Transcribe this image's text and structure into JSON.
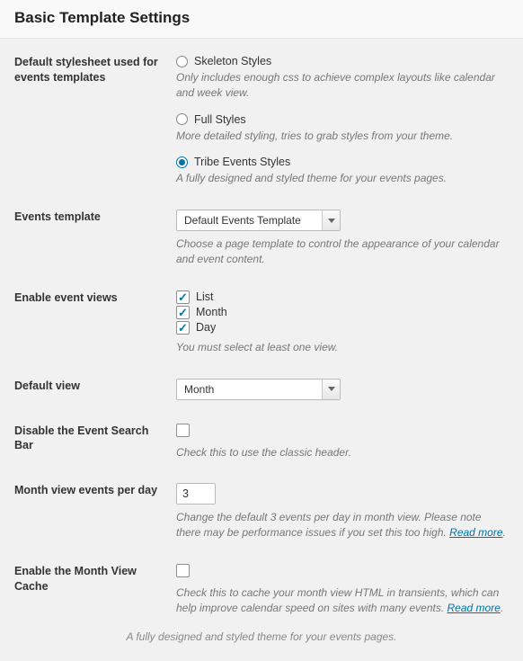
{
  "header": {
    "title": "Basic Template Settings"
  },
  "stylesheet": {
    "label": "Default stylesheet used for events templates",
    "options": [
      {
        "label": "Skeleton Styles",
        "desc": "Only includes enough css to achieve complex layouts like calendar and week view.",
        "checked": false
      },
      {
        "label": "Full Styles",
        "desc": "More detailed styling, tries to grab styles from your theme.",
        "checked": false
      },
      {
        "label": "Tribe Events Styles",
        "desc": "A fully designed and styled theme for your events pages.",
        "checked": true
      }
    ]
  },
  "template": {
    "label": "Events template",
    "value": "Default Events Template",
    "desc": "Choose a page template to control the appearance of your calendar and event content."
  },
  "views": {
    "label": "Enable event views",
    "items": [
      {
        "label": "List",
        "checked": true
      },
      {
        "label": "Month",
        "checked": true
      },
      {
        "label": "Day",
        "checked": true
      }
    ],
    "desc": "You must select at least one view."
  },
  "default_view": {
    "label": "Default view",
    "value": "Month"
  },
  "disable_search": {
    "label": "Disable the Event Search Bar",
    "checked": false,
    "desc": "Check this to use the classic header."
  },
  "month_per_day": {
    "label": "Month view events per day",
    "value": "3",
    "desc": "Change the default 3 events per day in month view. Please note there may be performance issues if you set this too high. ",
    "link": "Read more",
    "period": "."
  },
  "month_cache": {
    "label": "Enable the Month View Cache",
    "checked": false,
    "desc": "Check this to cache your month view HTML in transients, which can help improve calendar speed on sites with many events. ",
    "link": "Read more",
    "period": "."
  },
  "footer_note": "A fully designed and styled theme for your events pages."
}
